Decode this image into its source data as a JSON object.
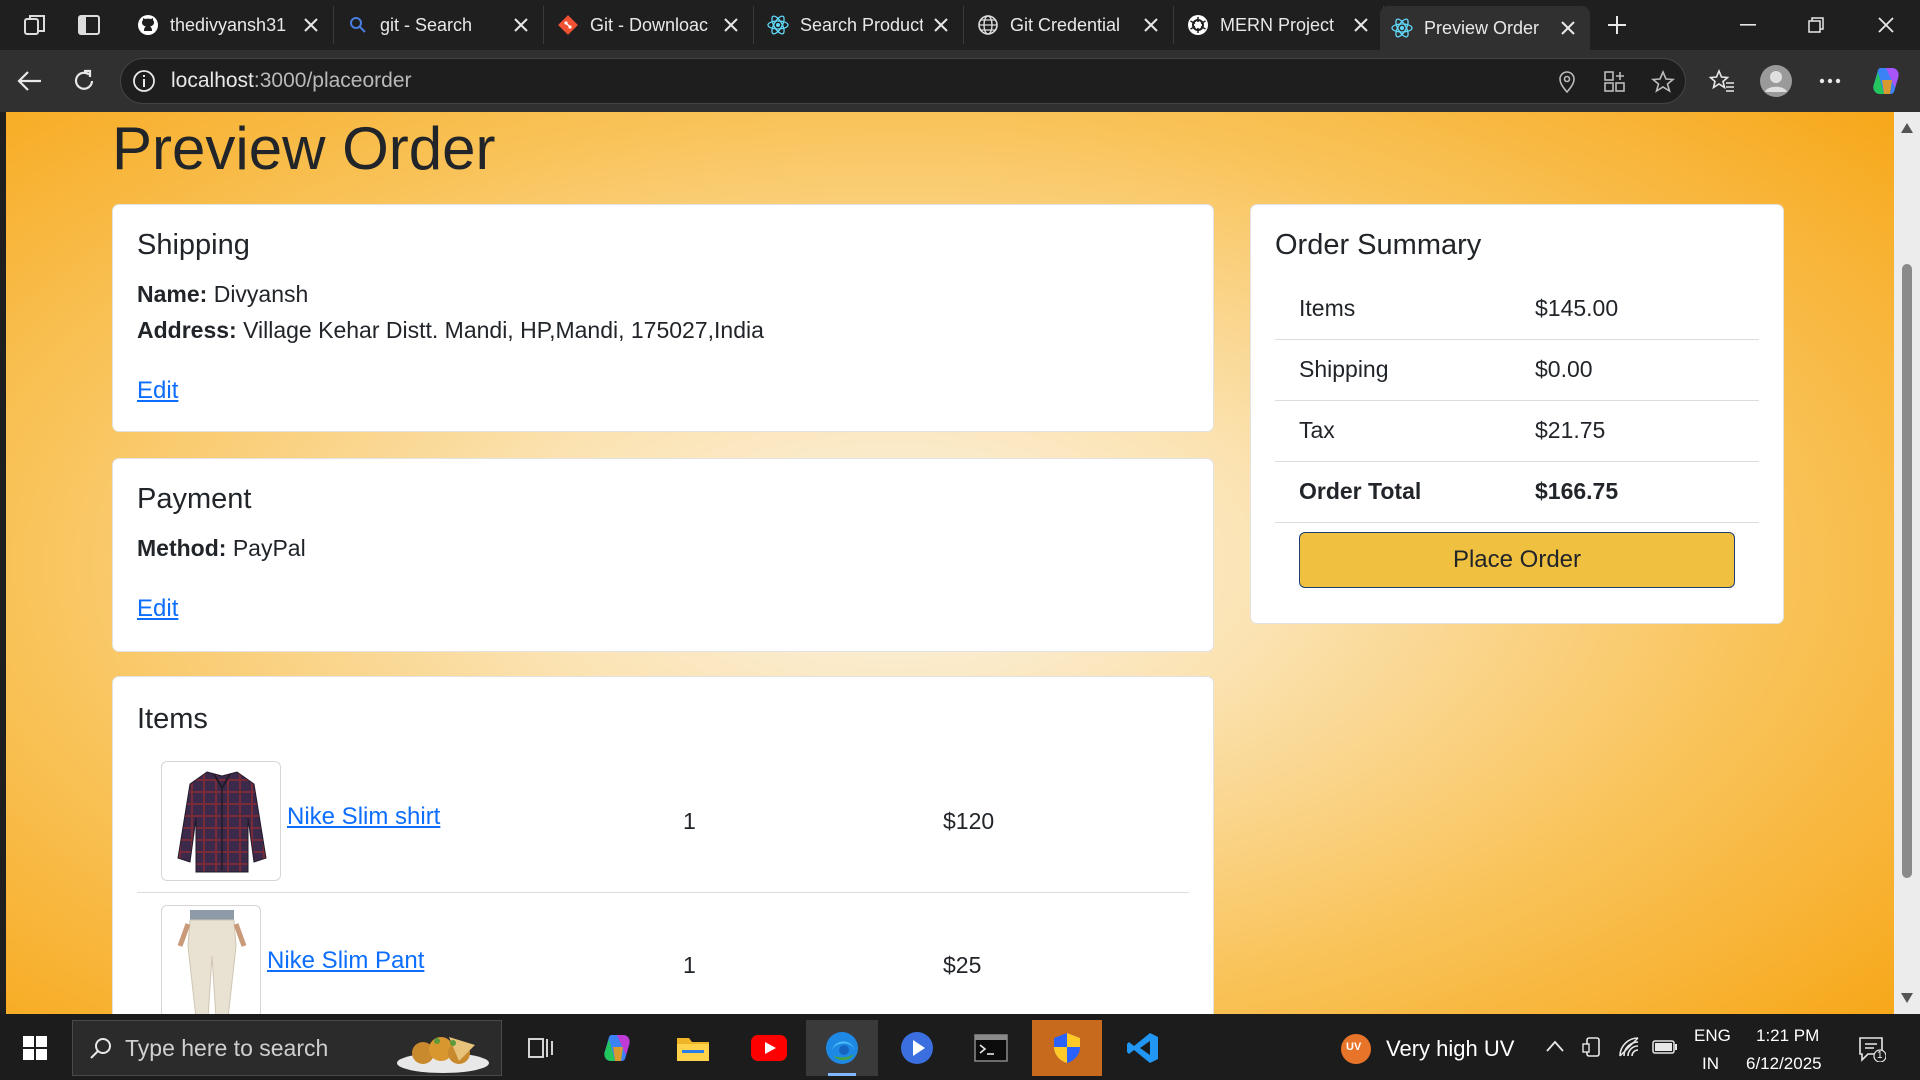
{
  "browser": {
    "tabs": [
      {
        "title": "thedivyansh31",
        "icon": "github-icon"
      },
      {
        "title": "git - Search",
        "icon": "search-icon"
      },
      {
        "title": "Git - Downloac",
        "icon": "git-icon"
      },
      {
        "title": "Search Producti",
        "icon": "react-icon"
      },
      {
        "title": "Git Credential",
        "icon": "globe-icon"
      },
      {
        "title": "MERN Project",
        "icon": "openai-icon"
      },
      {
        "title": "Preview Order",
        "icon": "react-icon"
      }
    ],
    "url_host": "localhost",
    "url_path": ":3000/placeorder"
  },
  "page": {
    "title": "Preview Order",
    "shipping": {
      "heading": "Shipping",
      "name_label": "Name:",
      "name_value": "Divyansh",
      "address_label": "Address:",
      "address_value": "Village Kehar Distt. Mandi, HP,Mandi, 175027,India",
      "edit_label": "Edit"
    },
    "payment": {
      "heading": "Payment",
      "method_label": "Method:",
      "method_value": "PayPal",
      "edit_label": "Edit"
    },
    "items": {
      "heading": "Items",
      "rows": [
        {
          "name": "Nike Slim shirt",
          "qty": "1",
          "price": "$120"
        },
        {
          "name": "Nike Slim Pant",
          "qty": "1",
          "price": "$25"
        }
      ]
    },
    "summary": {
      "heading": "Order Summary",
      "rows": [
        {
          "label": "Items",
          "value": "$145.00"
        },
        {
          "label": "Shipping",
          "value": "$0.00"
        },
        {
          "label": "Tax",
          "value": "$21.75"
        },
        {
          "label": "Order Total",
          "value": "$166.75"
        }
      ],
      "button_label": "Place Order"
    }
  },
  "taskbar": {
    "search_placeholder": "Type here to search",
    "weather_badge": "UV",
    "weather_text": "Very high UV",
    "lang_top": "ENG",
    "lang_bottom": "IN",
    "time": "1:21 PM",
    "date": "6/12/2025",
    "notification_count": "1"
  },
  "colors": {
    "accent_button": "#f0c040",
    "link": "#0d6efd",
    "page_gradient_edge": "#f7a81b"
  }
}
